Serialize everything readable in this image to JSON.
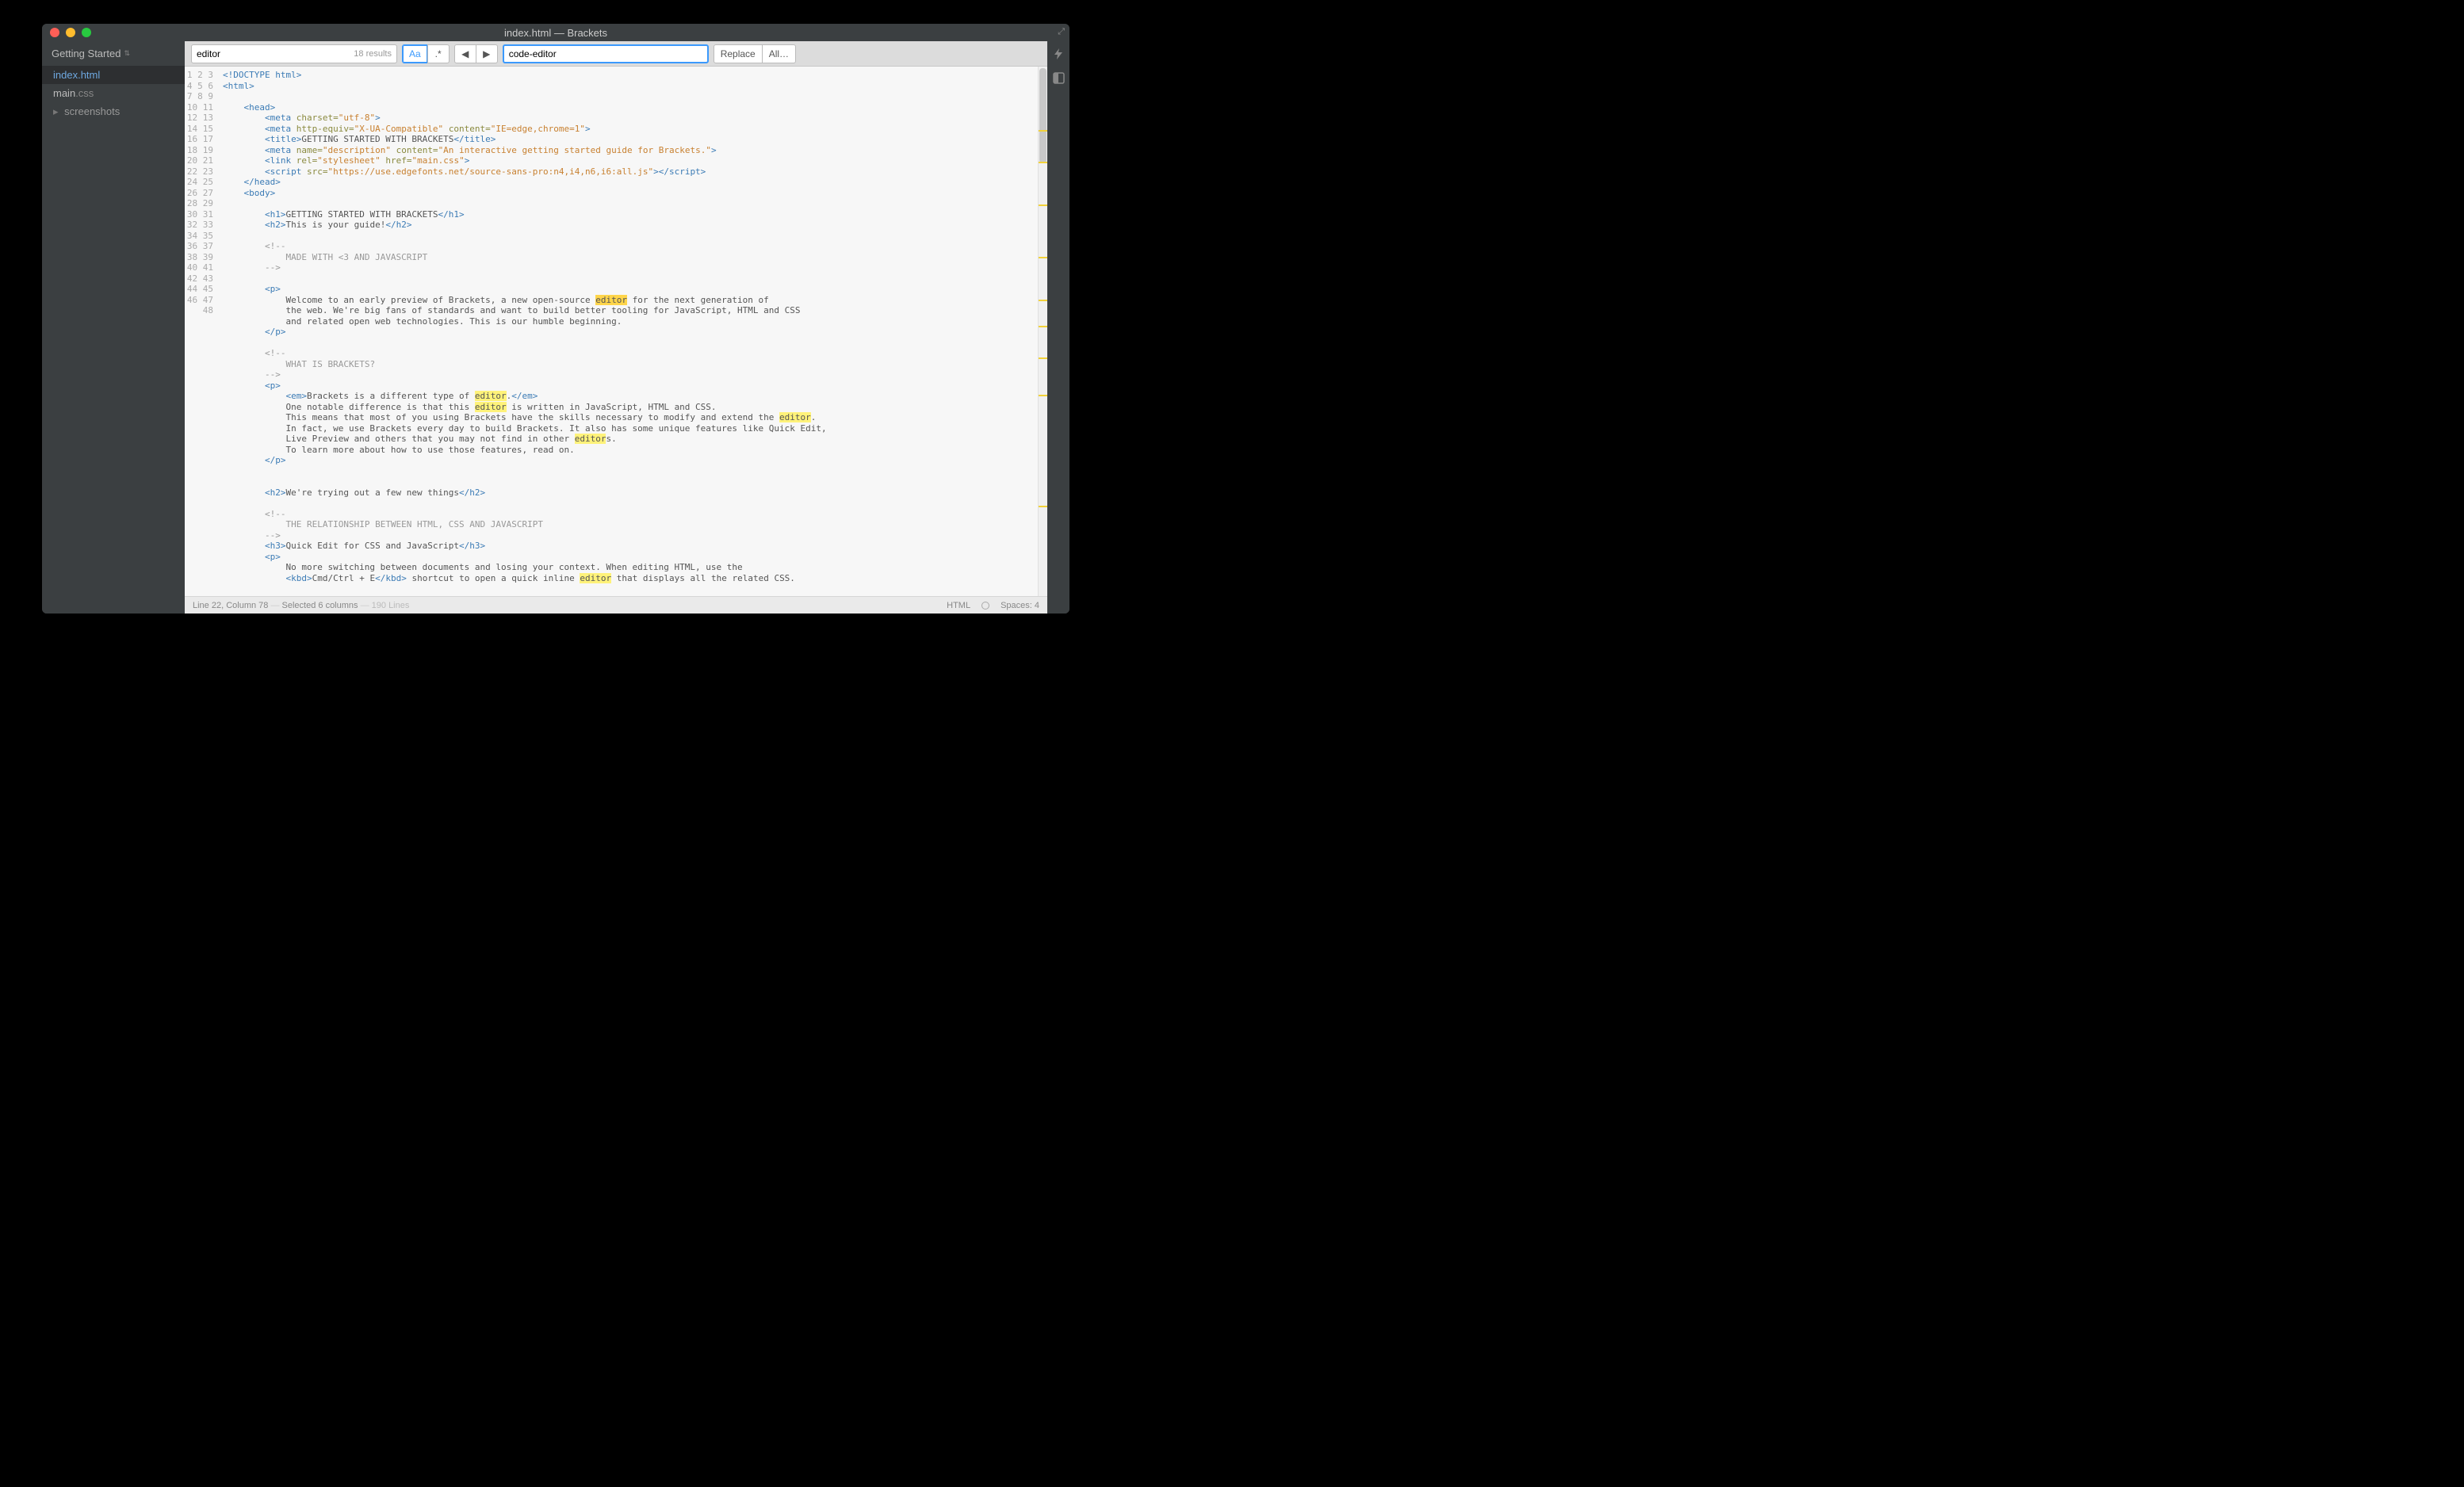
{
  "titlebar": {
    "title": "index.html — Brackets",
    "traffic": {
      "close": "#ff5f57",
      "min": "#ffbd2e",
      "max": "#28c940"
    }
  },
  "sidebar": {
    "header": "Getting Started",
    "dropdown_glyph": "▸",
    "items": [
      {
        "name": "index.html",
        "active": true
      },
      {
        "name_pre": "main",
        "name_ext": ".css",
        "active": false
      }
    ],
    "folder": {
      "caret": "▸",
      "label": "screenshots"
    }
  },
  "findbar": {
    "find_value": "editor",
    "results": "18 results",
    "case_label": "Aa",
    "regex_label": ".*",
    "prev": "◀",
    "next": "▶",
    "replace_value": "code-editor",
    "replace_btn": "Replace",
    "all_btn": "All…"
  },
  "code": {
    "line_start": 1,
    "line_end": 48,
    "rows": [
      [
        [
          "tag",
          "<!DOCTYPE html>"
        ]
      ],
      [
        [
          "tag",
          "<html>"
        ]
      ],
      [],
      [
        [
          "txt",
          "    "
        ],
        [
          "tag",
          "<head>"
        ]
      ],
      [
        [
          "txt",
          "        "
        ],
        [
          "tag",
          "<meta"
        ],
        [
          "txt",
          " "
        ],
        [
          "attr",
          "charset="
        ],
        [
          "str",
          "\"utf-8\""
        ],
        [
          "tag",
          ">"
        ]
      ],
      [
        [
          "txt",
          "        "
        ],
        [
          "tag",
          "<meta"
        ],
        [
          "txt",
          " "
        ],
        [
          "attr",
          "http-equiv="
        ],
        [
          "str",
          "\"X-UA-Compatible\""
        ],
        [
          "txt",
          " "
        ],
        [
          "attr",
          "content="
        ],
        [
          "str",
          "\"IE=edge,chrome=1\""
        ],
        [
          "tag",
          ">"
        ]
      ],
      [
        [
          "txt",
          "        "
        ],
        [
          "tag",
          "<title>"
        ],
        [
          "txt",
          "GETTING STARTED WITH BRACKETS"
        ],
        [
          "tag",
          "</title>"
        ]
      ],
      [
        [
          "txt",
          "        "
        ],
        [
          "tag",
          "<meta"
        ],
        [
          "txt",
          " "
        ],
        [
          "attr",
          "name="
        ],
        [
          "str",
          "\"description\""
        ],
        [
          "txt",
          " "
        ],
        [
          "attr",
          "content="
        ],
        [
          "str",
          "\"An interactive getting started guide for Brackets.\""
        ],
        [
          "tag",
          ">"
        ]
      ],
      [
        [
          "txt",
          "        "
        ],
        [
          "tag",
          "<link"
        ],
        [
          "txt",
          " "
        ],
        [
          "attr",
          "rel="
        ],
        [
          "str",
          "\"stylesheet\""
        ],
        [
          "txt",
          " "
        ],
        [
          "attr",
          "href="
        ],
        [
          "str",
          "\"main.css\""
        ],
        [
          "tag",
          ">"
        ]
      ],
      [
        [
          "txt",
          "        "
        ],
        [
          "tag",
          "<script"
        ],
        [
          "txt",
          " "
        ],
        [
          "attr",
          "src="
        ],
        [
          "str",
          "\"https://use.edgefonts.net/source-sans-pro:n4,i4,n6,i6:all.js\""
        ],
        [
          "tag",
          ">"
        ],
        [
          "tag",
          "</script>"
        ]
      ],
      [
        [
          "txt",
          "    "
        ],
        [
          "tag",
          "</head>"
        ]
      ],
      [
        [
          "txt",
          "    "
        ],
        [
          "tag",
          "<body>"
        ]
      ],
      [],
      [
        [
          "txt",
          "        "
        ],
        [
          "tag",
          "<h1>"
        ],
        [
          "txt",
          "GETTING STARTED WITH BRACKETS"
        ],
        [
          "tag",
          "</h1>"
        ]
      ],
      [
        [
          "txt",
          "        "
        ],
        [
          "tag",
          "<h2>"
        ],
        [
          "txt",
          "This is your guide!"
        ],
        [
          "tag",
          "</h2>"
        ]
      ],
      [],
      [
        [
          "txt",
          "        "
        ],
        [
          "cmt",
          "<!--"
        ]
      ],
      [
        [
          "txt",
          "            "
        ],
        [
          "cmt",
          "MADE WITH <3 AND JAVASCRIPT"
        ]
      ],
      [
        [
          "txt",
          "        "
        ],
        [
          "cmt",
          "-->"
        ]
      ],
      [],
      [
        [
          "txt",
          "        "
        ],
        [
          "tag",
          "<p>"
        ]
      ],
      [
        [
          "txt",
          "            Welcome to an early preview of Brackets, a new open-source "
        ],
        [
          "hl-sel",
          "editor"
        ],
        [
          "txt",
          " for the next generation of"
        ]
      ],
      [
        [
          "txt",
          "            the web. We're big fans of standards and want to build better tooling for JavaScript, HTML and CSS"
        ]
      ],
      [
        [
          "txt",
          "            and related open web technologies. This is our humble beginning."
        ]
      ],
      [
        [
          "txt",
          "        "
        ],
        [
          "tag",
          "</p>"
        ]
      ],
      [],
      [
        [
          "txt",
          "        "
        ],
        [
          "cmt",
          "<!--"
        ]
      ],
      [
        [
          "txt",
          "            "
        ],
        [
          "cmt",
          "WHAT IS BRACKETS?"
        ]
      ],
      [
        [
          "txt",
          "        "
        ],
        [
          "cmt",
          "-->"
        ]
      ],
      [
        [
          "txt",
          "        "
        ],
        [
          "tag",
          "<p>"
        ]
      ],
      [
        [
          "txt",
          "            "
        ],
        [
          "tag",
          "<em>"
        ],
        [
          "txt",
          "Brackets is a different type of "
        ],
        [
          "hl",
          "editor"
        ],
        [
          "txt",
          "."
        ],
        [
          "tag",
          "</em>"
        ]
      ],
      [
        [
          "txt",
          "            One notable difference is that this "
        ],
        [
          "hl",
          "editor"
        ],
        [
          "txt",
          " is written in JavaScript, HTML and CSS."
        ]
      ],
      [
        [
          "txt",
          "            This means that most of you using Brackets have the skills necessary to modify and extend the "
        ],
        [
          "hl",
          "editor"
        ],
        [
          "txt",
          "."
        ]
      ],
      [
        [
          "txt",
          "            In fact, we use Brackets every day to build Brackets. It also has some unique features like Quick Edit,"
        ]
      ],
      [
        [
          "txt",
          "            Live Preview and others that you may not find in other "
        ],
        [
          "hl",
          "editor"
        ],
        [
          "txt",
          "s."
        ]
      ],
      [
        [
          "txt",
          "            To learn more about how to use those features, read on."
        ]
      ],
      [
        [
          "txt",
          "        "
        ],
        [
          "tag",
          "</p>"
        ]
      ],
      [],
      [],
      [
        [
          "txt",
          "        "
        ],
        [
          "tag",
          "<h2>"
        ],
        [
          "txt",
          "We're trying out a few new things"
        ],
        [
          "tag",
          "</h2>"
        ]
      ],
      [],
      [
        [
          "txt",
          "        "
        ],
        [
          "cmt",
          "<!--"
        ]
      ],
      [
        [
          "txt",
          "            "
        ],
        [
          "cmt",
          "THE RELATIONSHIP BETWEEN HTML, CSS AND JAVASCRIPT"
        ]
      ],
      [
        [
          "txt",
          "        "
        ],
        [
          "cmt",
          "-->"
        ]
      ],
      [
        [
          "txt",
          "        "
        ],
        [
          "tag",
          "<h3>"
        ],
        [
          "txt",
          "Quick Edit for CSS and JavaScript"
        ],
        [
          "tag",
          "</h3>"
        ]
      ],
      [
        [
          "txt",
          "        "
        ],
        [
          "tag",
          "<p>"
        ]
      ],
      [
        [
          "txt",
          "            No more switching between documents and losing your context. When editing HTML, use the"
        ]
      ],
      [
        [
          "txt",
          "            "
        ],
        [
          "tag",
          "<kbd>"
        ],
        [
          "txt",
          "Cmd/Ctrl + E"
        ],
        [
          "tag",
          "</kbd>"
        ],
        [
          "txt",
          " shortcut to open a quick inline "
        ],
        [
          "hl",
          "editor"
        ],
        [
          "txt",
          " that displays all the related CSS."
        ]
      ]
    ]
  },
  "scrollbar_marks": [
    12,
    18,
    26,
    36,
    44,
    49,
    55,
    62,
    83
  ],
  "statusbar": {
    "cursor": "Line 22, Column 78",
    "sep": " — ",
    "selection": "Selected 6 columns",
    "lines": "190 Lines",
    "lang": "HTML",
    "spaces": "Spaces: 4"
  },
  "rail": {
    "bolt": "⚡",
    "ext": "◧"
  }
}
